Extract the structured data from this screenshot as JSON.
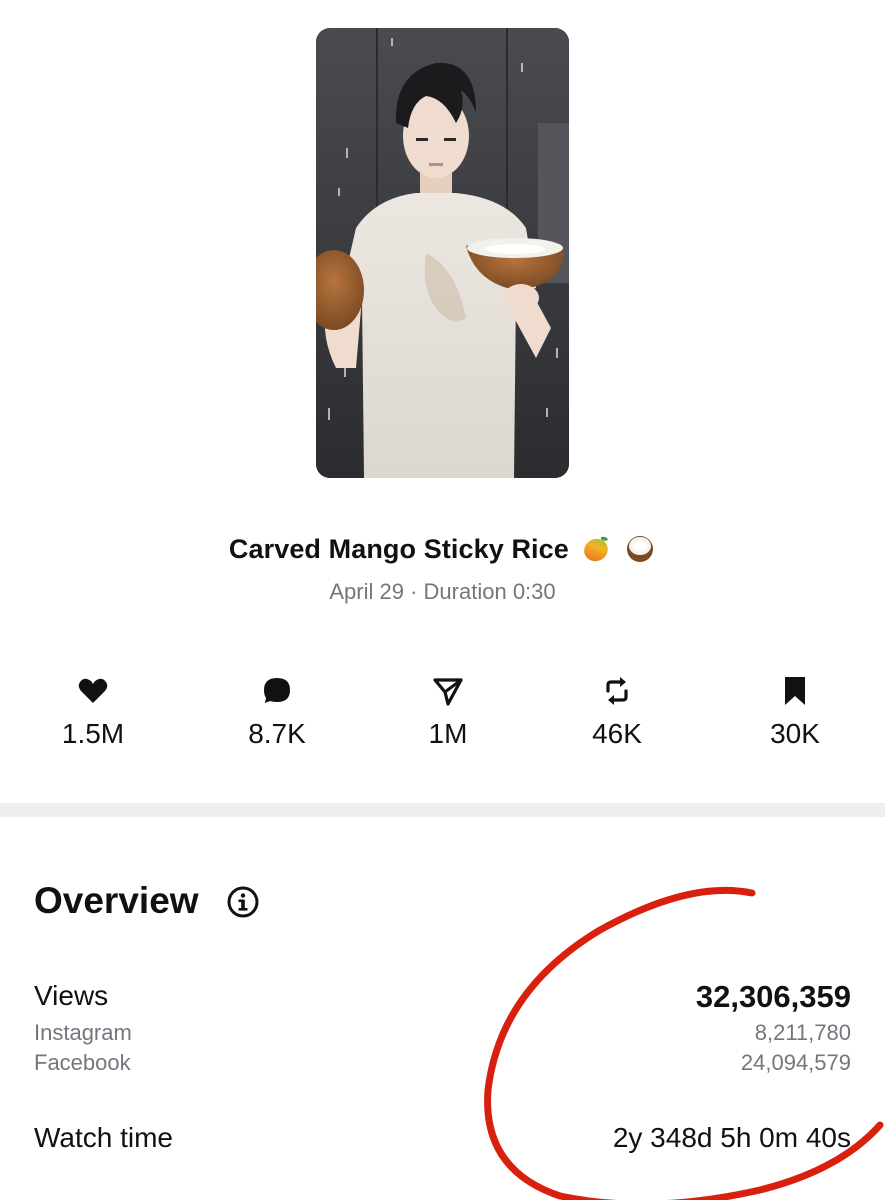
{
  "post": {
    "title": "Carved Mango Sticky Rice",
    "title_emojis": [
      "mango-emoji",
      "coconut-emoji"
    ],
    "date": "April 29",
    "separator": "·",
    "duration_label": "Duration",
    "duration": "0:30"
  },
  "stats": [
    {
      "icon": "heart-icon",
      "value": "1.5M"
    },
    {
      "icon": "comment-icon",
      "value": "8.7K"
    },
    {
      "icon": "share-icon",
      "value": "1M"
    },
    {
      "icon": "repost-icon",
      "value": "46K"
    },
    {
      "icon": "bookmark-icon",
      "value": "30K"
    }
  ],
  "overview": {
    "title": "Overview",
    "info_icon": "info-icon",
    "views": {
      "label": "Views",
      "total": "32,306,359",
      "breakdown": [
        {
          "label": "Instagram",
          "value": "8,211,780"
        },
        {
          "label": "Facebook",
          "value": "24,094,579"
        }
      ]
    },
    "watch_time": {
      "label": "Watch time",
      "value": "2y 348d 5h 0m 40s"
    }
  },
  "colors": {
    "text": "#111111",
    "muted": "#73777d",
    "divider": "#efeff1",
    "annotation": "#d9200f"
  }
}
